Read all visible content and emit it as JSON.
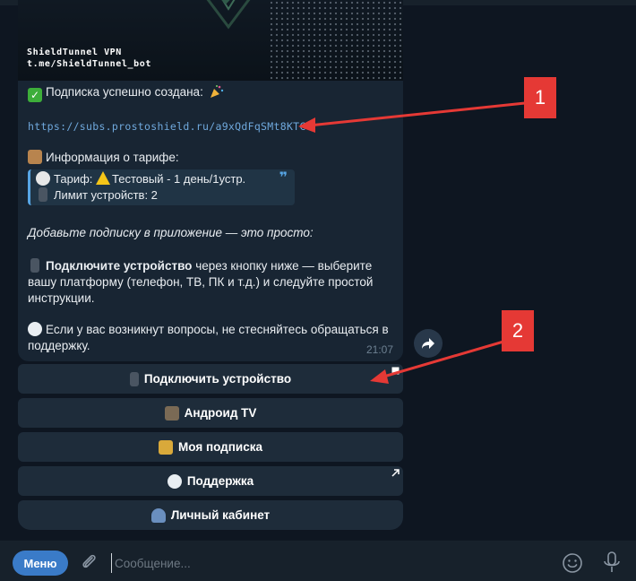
{
  "banner": {
    "caption_line1": "ShieldTunnel VPN",
    "caption_line2": "t.me/ShieldTunnel_bot"
  },
  "message": {
    "success_line": "Подписка успешно создана:",
    "link": "https://subs.prostoshield.ru/a9xQdFqSMt8KTC",
    "tariff_header": "Информация о тарифе:",
    "tariff_label": "Тариф:",
    "tariff_value": "Тестовый - 1 день/1устр.",
    "devices_line": "Лимит устройств: 2",
    "add_hint": "Добавьте подписку в приложение — это просто:",
    "connect_bold": "Подключите устройство",
    "connect_rest_1": " через кнопку ниже — выберите",
    "connect_line2": "вашу платформу (телефон, ТВ, ПК и т.д.) и следуйте простой",
    "connect_line3": "инструкции.",
    "support_line1": "Если у вас возникнут вопросы, не стесняйтесь обращаться в",
    "support_line2": "поддержку.",
    "time": "21:07"
  },
  "keyboard": {
    "buttons": [
      {
        "label": "Подключить устройство",
        "icon": "phone-arrow-icon"
      },
      {
        "label": "Андроид TV",
        "icon": "tv-icon"
      },
      {
        "label": "Моя подписка",
        "icon": "lock-key-icon"
      },
      {
        "label": "Поддержка",
        "icon": "speech-bubble-icon"
      },
      {
        "label": "Личный кабинет",
        "icon": "user-silhouette-icon"
      }
    ]
  },
  "annotations": {
    "marker1": "1",
    "marker2": "2",
    "color": "#e53935"
  },
  "composer": {
    "menu_label": "Меню",
    "placeholder": "Сообщение..."
  },
  "colors": {
    "background": "#0e1621",
    "bubble": "#182533",
    "accent": "#3a7bc8",
    "link": "#6fa8dc"
  }
}
